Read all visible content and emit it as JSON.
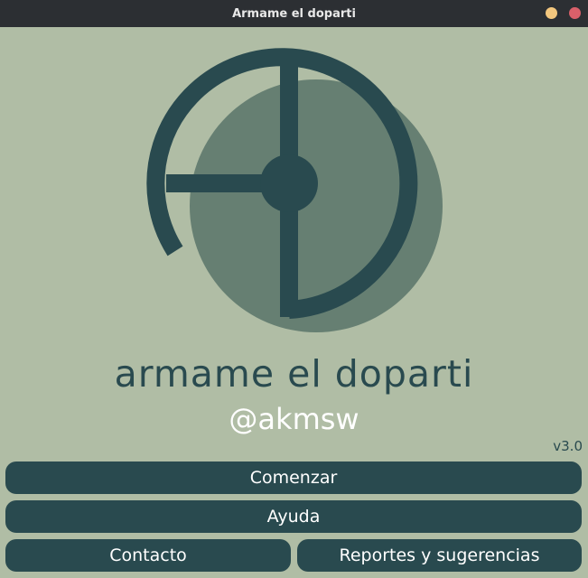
{
  "window": {
    "title": "Armame el doparti"
  },
  "branding": {
    "app_name": "armame el doparti",
    "handle": "@akmsw",
    "version": "v3.0"
  },
  "buttons": {
    "start": "Comenzar",
    "help": "Ayuda",
    "contact": "Contacto",
    "reports": "Reportes y sugerencias"
  },
  "colors": {
    "background": "#b0bda5",
    "primary": "#294a4f",
    "logo_circle": "#667f72",
    "titlebar": "#2c2f33"
  }
}
